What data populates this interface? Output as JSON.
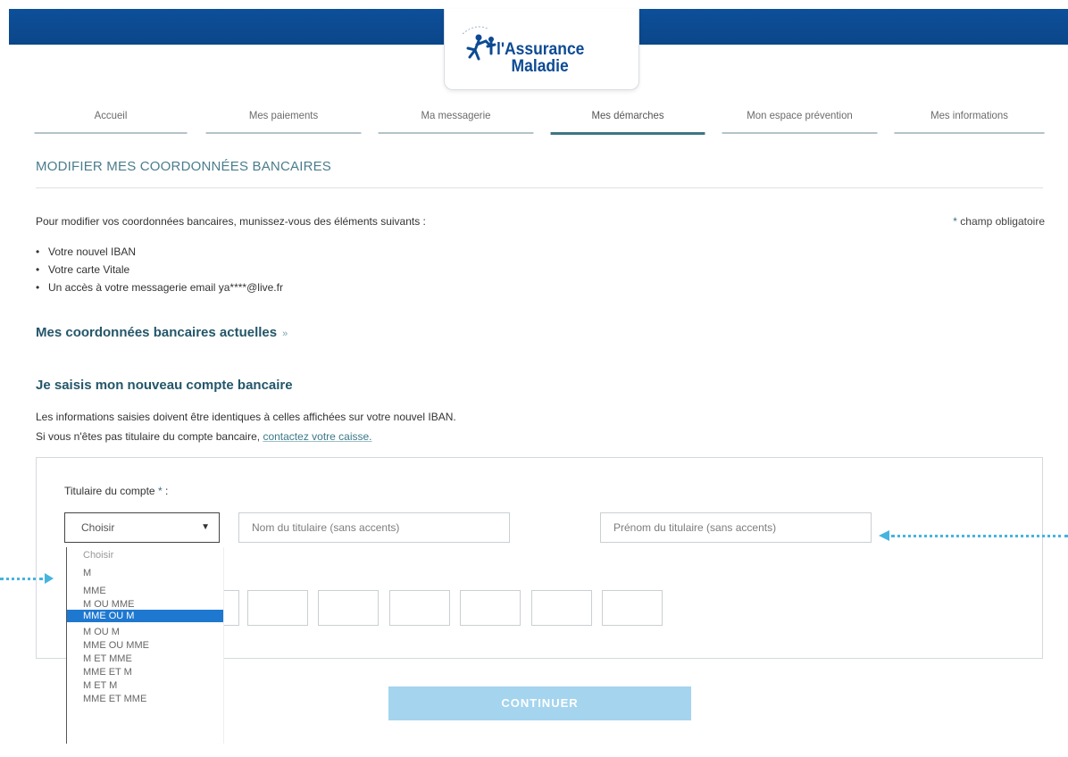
{
  "header": {
    "logo_line1": "l'Assurance",
    "logo_line2": "Maladie",
    "brand_color": "#0c4a94"
  },
  "nav": {
    "tabs": [
      {
        "label": "Accueil"
      },
      {
        "label": "Mes paiements"
      },
      {
        "label": "Ma messagerie"
      },
      {
        "label": "Mes démarches",
        "active": true
      },
      {
        "label": "Mon espace prévention"
      },
      {
        "label": "Mes informations"
      }
    ]
  },
  "page": {
    "title": "MODIFIER MES COORDONNÉES BANCAIRES",
    "intro": "Pour modifier vos coordonnées bancaires, munissez-vous des éléments suivants :",
    "required_star": "*",
    "required_note": "champ obligatoire",
    "requirements": [
      "Votre nouvel IBAN",
      "Votre carte Vitale",
      "Un accès à votre messagerie email ya****@live.fr"
    ],
    "current_section": "Mes coordonnées bancaires actuelles",
    "current_section_chevron": "»",
    "new_section": "Je saisis mon nouveau compte bancaire",
    "info_line1": "Les informations saisies doivent être identiques à celles affichées sur votre nouvel IBAN.",
    "info_line2_prefix": "Si vous n'êtes pas titulaire du compte bancaire,",
    "info_line2_link": "contactez votre caisse."
  },
  "form": {
    "holder_label": "Titulaire du compte",
    "holder_label_suffix": " :",
    "civility_select": {
      "value": "Choisir",
      "arrow": "▼",
      "options": [
        "Choisir",
        "M",
        "MME",
        "M OU MME",
        "MME OU M",
        "M OU M",
        "MME OU MME",
        "M ET MME",
        "MME ET M",
        "M ET M",
        "MME ET MME"
      ],
      "highlighted": "MME OU M"
    },
    "lastname_placeholder": "Nom du titulaire (sans accents)",
    "firstname_placeholder": "Prénom du titulaire (sans accents)",
    "iban_cells": 7
  },
  "actions": {
    "continue_label": "CONTINUER"
  },
  "colors": {
    "accent": "#4a7d8c",
    "button": "#a4d4ee",
    "highlight": "#1e78d0",
    "annotation_arrow": "#47b3df"
  }
}
